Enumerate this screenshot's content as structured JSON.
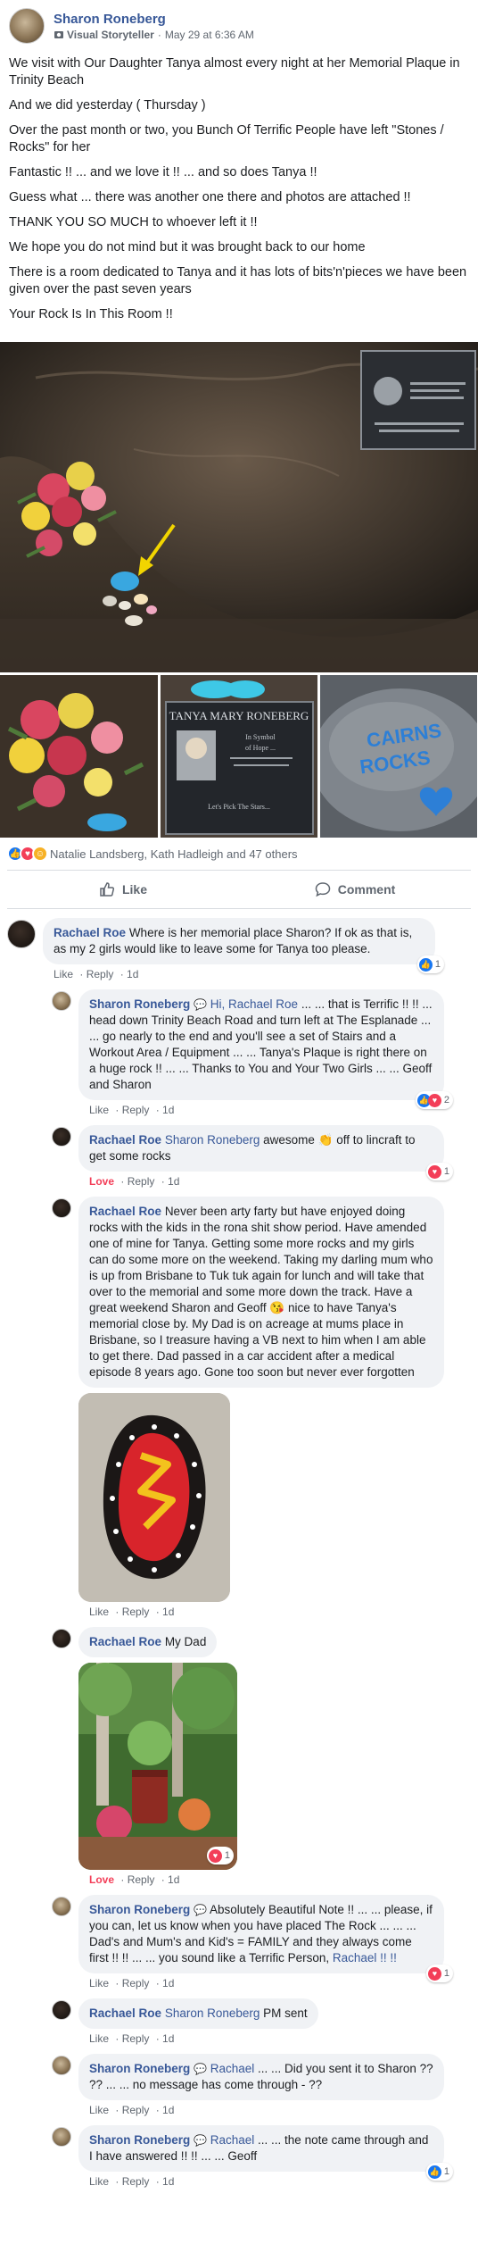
{
  "post": {
    "author": "Sharon Roneberg",
    "badge": "Visual Storyteller",
    "timestamp": "May 29 at 6:36 AM",
    "paragraphs": [
      "We visit with Our Daughter Tanya almost every night at her Memorial Plaque in Trinity Beach",
      "And we did yesterday ( Thursday )",
      "Over the past month or two, you Bunch Of Terrific People have left \"Stones / Rocks\" for her",
      "Fantastic !! ... and we love it !! ... and so does Tanya !!",
      "Guess what ... there was another one there and photos are attached !!",
      "THANK YOU SO MUCH to whoever left it !!",
      "We hope you do not mind but it was brought back to our home",
      "There is a room dedicated to Tanya and it has lots of bits'n'pieces we have been given over the past seven years",
      "Your Rock Is In This Room !!"
    ]
  },
  "photos": {
    "plaque_name": "TANYA MARY RONEBERG",
    "plaque_line1": "In Symbol",
    "plaque_line2": "of Hope ...",
    "plaque_quote": "Let's Pick The Stars...",
    "rock_text_1": "CAIRNS",
    "rock_text_2": "ROCKS"
  },
  "reactions": {
    "summary": "Natalie Landsberg, Kath Hadleigh and 47 others"
  },
  "actions": {
    "like": "Like",
    "comment": "Comment"
  },
  "comments": [
    {
      "author": "Rachael Roe",
      "text": "Where is her memorial place Sharon? If ok as that is, as my 2 girls would like to leave some for Tanya too please.",
      "actions": [
        "Like",
        "Reply",
        "1d"
      ],
      "reaction_count": "1"
    },
    {
      "author": "Sharon Roneberg",
      "mention": "Hi, Rachael Roe",
      "text": "... ... that is Terrific !! !! ... head down Trinity Beach Road and turn left at The Esplanade ... ... go nearly to the end and you'll see a set of Stairs and a Workout Area / Equipment ... ... Tanya's Plaque is right there on a huge rock !! ... ... Thanks to You and Your Two Girls ... ... Geoff and Sharon",
      "actions": [
        "Like",
        "Reply",
        "1d"
      ],
      "reaction_count": "2"
    },
    {
      "author": "Rachael Roe",
      "mention": "Sharon Roneberg",
      "text": "awesome 👏 off to lincraft to get some rocks",
      "actions": [
        "Love",
        "Reply",
        "1d"
      ],
      "reaction_count": "1"
    },
    {
      "author": "Rachael Roe",
      "text": "Never been arty farty but have enjoyed doing rocks with the kids in the rona shit show period. Have amended one of mine for Tanya. Getting some more rocks and my girls can do some more on the weekend. Taking my darling mum who is up from Brisbane to Tuk tuk again for lunch and will take that over to the memorial and some more down the track. Have a great weekend Sharon and Geoff 😘 nice to have Tanya's memorial close by. My Dad is on acreage at mums place in Brisbane, so I treasure having a VB next to him when I am able to get there. Dad passed in a car accident after a medical episode 8 years ago. Gone too soon but never ever forgotten",
      "actions": [
        "Like",
        "Reply",
        "1d"
      ]
    },
    {
      "author": "Rachael Roe",
      "text": "My Dad",
      "actions": [
        "Love",
        "Reply",
        "1d"
      ],
      "reaction_count": "1"
    },
    {
      "author": "Sharon Roneberg",
      "text": "Absolutely Beautiful Note !! ... ... please, if you can, let us know when you have placed The Rock ... ... ... Dad's and Mum's and Kid's = FAMILY and they always come first !! !! ... ... you sound like a Terrific Person,",
      "mention_end": "Rachael !! !!",
      "actions": [
        "Like",
        "Reply",
        "1d"
      ],
      "reaction_count": "1"
    },
    {
      "author": "Rachael Roe",
      "mention": "Sharon Roneberg",
      "text": "PM sent",
      "actions": [
        "Like",
        "Reply",
        "1d"
      ]
    },
    {
      "author": "Sharon Roneberg",
      "mention": "Rachael",
      "text": "... ... Did you sent it to Sharon ?? ?? ... ... no message has come through - ??",
      "actions": [
        "Like",
        "Reply",
        "1d"
      ]
    },
    {
      "author": "Sharon Roneberg",
      "mention": "Rachael",
      "text": "... ... the note came through and I have answered !! !! ... ... Geoff",
      "actions": [
        "Like",
        "Reply",
        "1d"
      ],
      "reaction_count": "1"
    }
  ],
  "colors": {
    "link": "#385898",
    "like_blue": "#1877f2",
    "love_red": "#f33e58",
    "bubble_bg": "#f0f2f5"
  }
}
